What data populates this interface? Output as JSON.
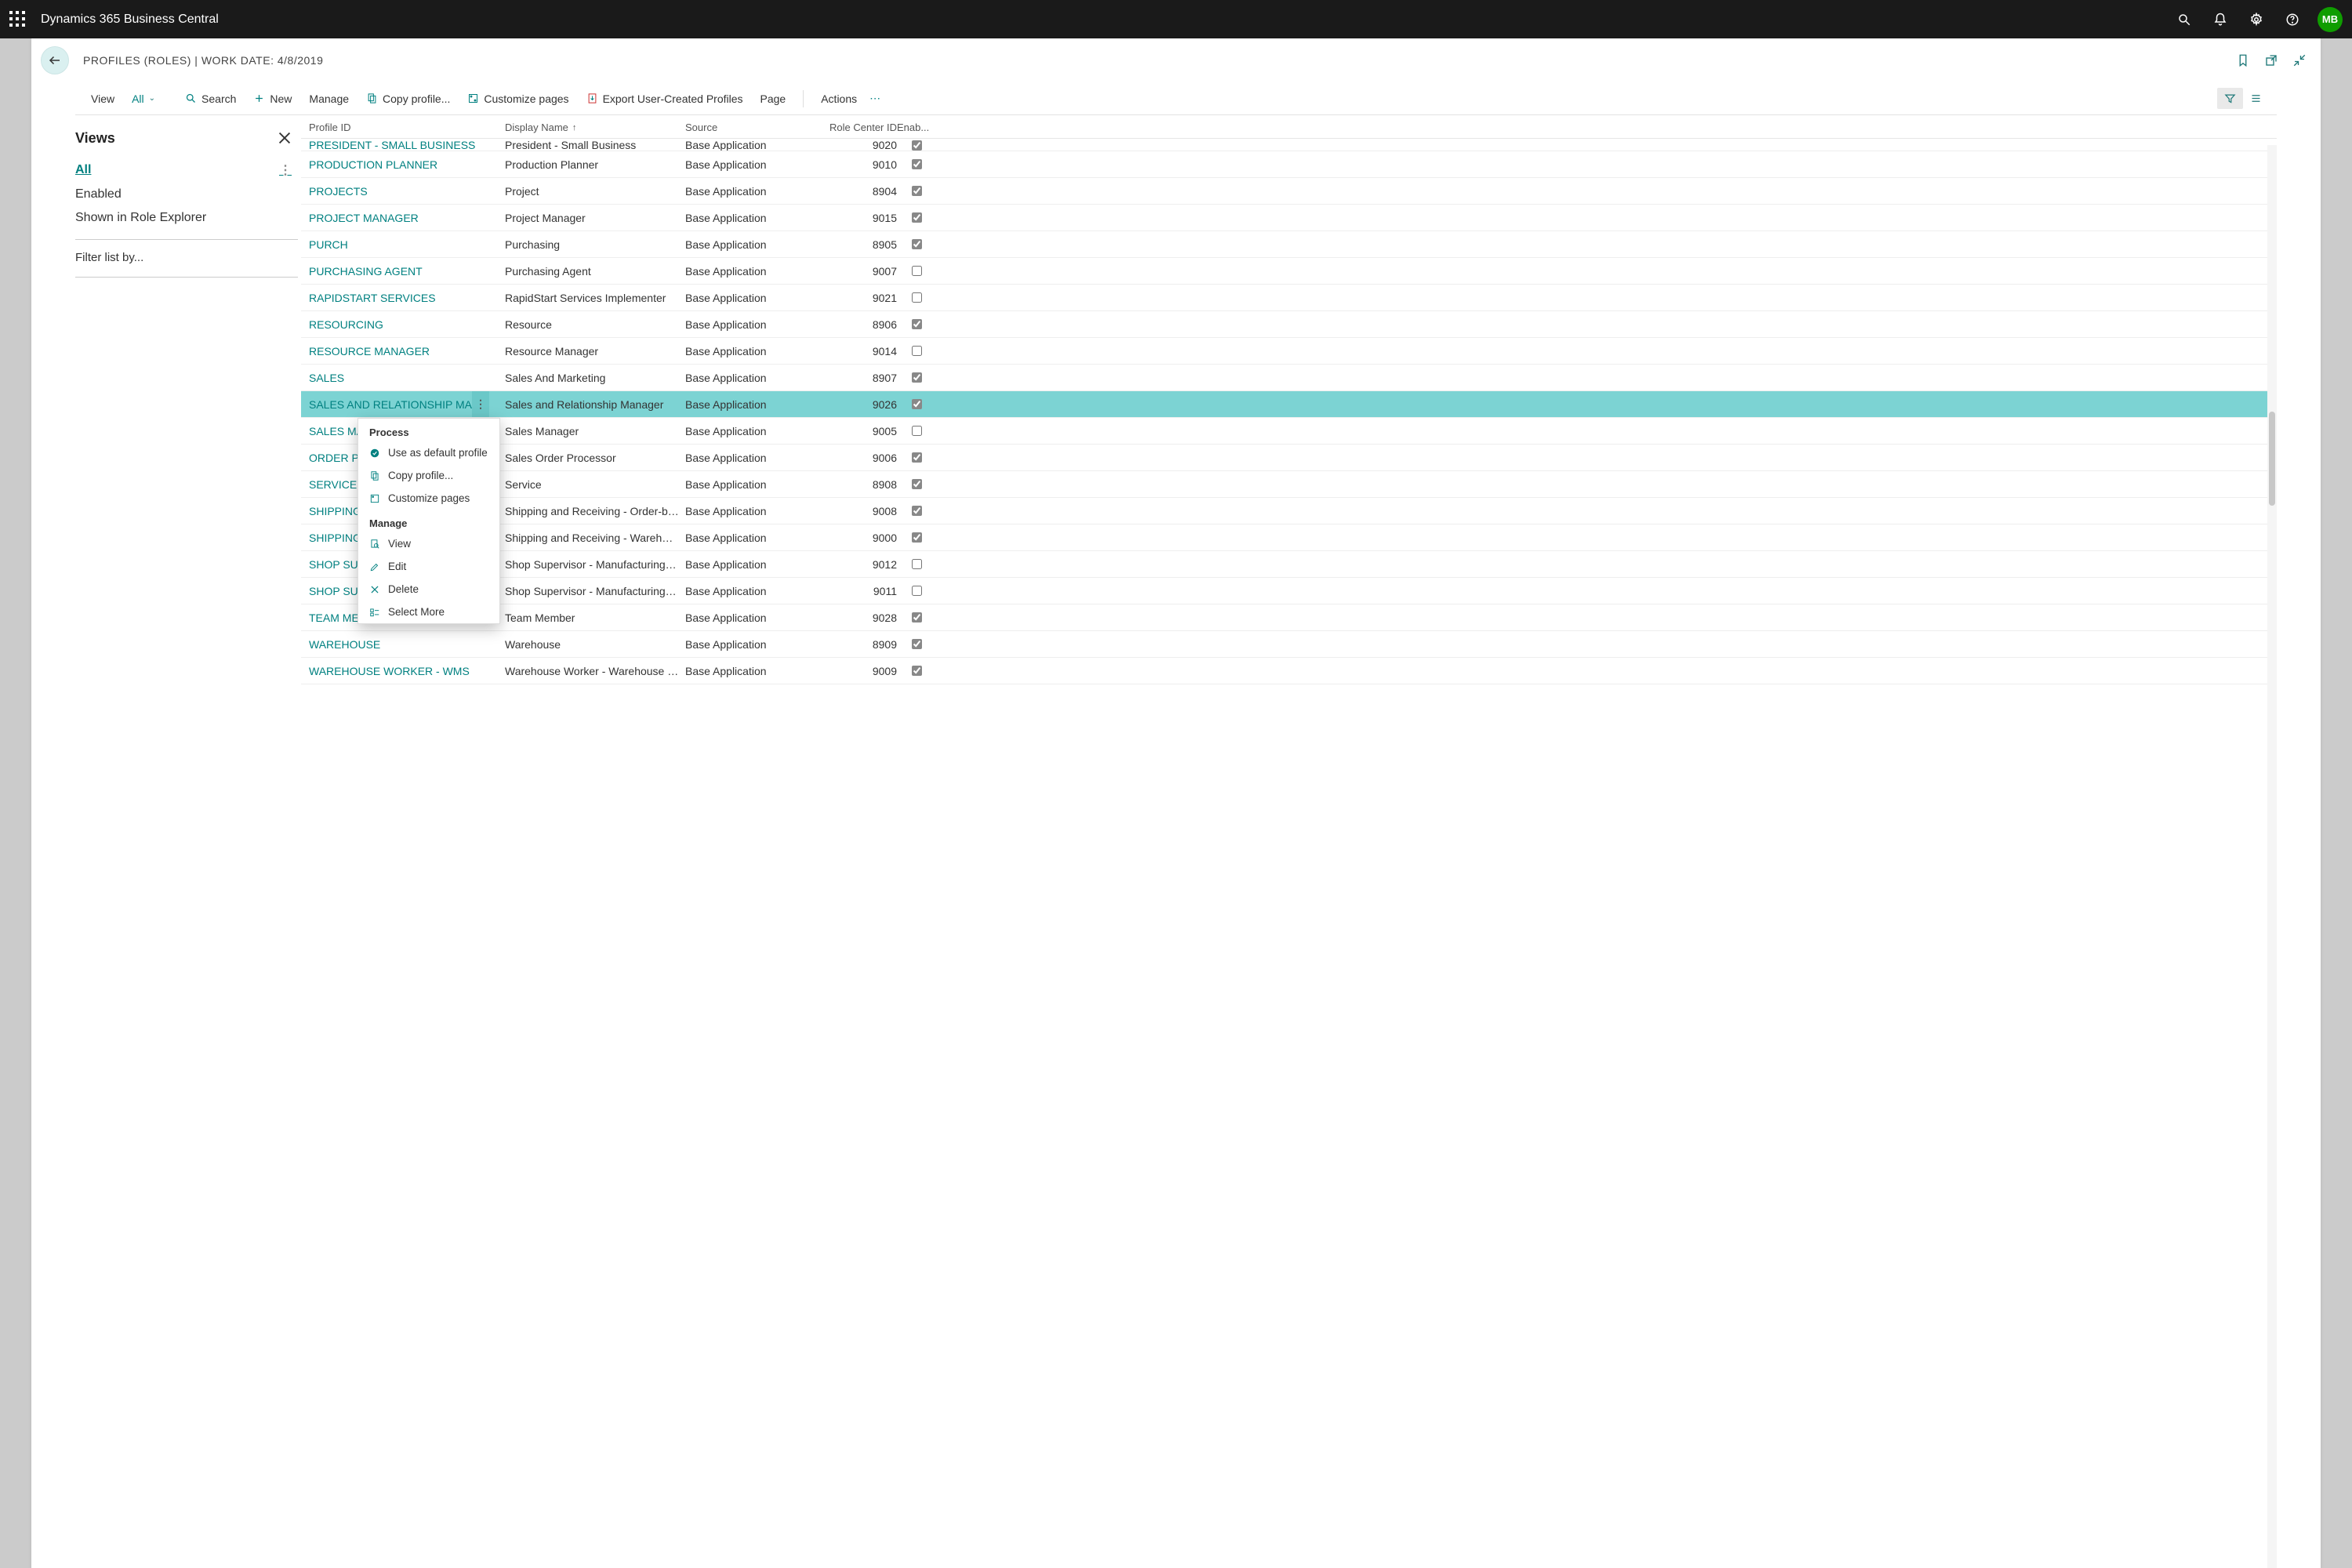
{
  "app_title": "Dynamics 365 Business Central",
  "avatar": "MB",
  "page_header": "PROFILES (ROLES) | WORK DATE: 4/8/2019",
  "toolbar": {
    "view": "View",
    "all": "All",
    "search": "Search",
    "new": "New",
    "manage": "Manage",
    "copy": "Copy profile...",
    "customize": "Customize pages",
    "export": "Export User-Created Profiles",
    "page": "Page",
    "actions": "Actions"
  },
  "sidebar": {
    "views_title": "Views",
    "items": [
      {
        "label": "All",
        "selected": true,
        "more": true
      },
      {
        "label": "Enabled",
        "selected": false
      },
      {
        "label": "Shown in Role Explorer",
        "selected": false
      }
    ],
    "filter_by": "Filter list by..."
  },
  "columns": {
    "profile_id": "Profile ID",
    "display_name": "Display Name",
    "source": "Source",
    "role_center": "Role Center ID",
    "enabled": "Enab..."
  },
  "rows": [
    {
      "pid": "PRESIDENT - SMALL BUSINESS",
      "dn": "President - Small Business",
      "src": "Base Application",
      "rc": "9020",
      "en": true,
      "top": true
    },
    {
      "pid": "PRODUCTION PLANNER",
      "dn": "Production Planner",
      "src": "Base Application",
      "rc": "9010",
      "en": true
    },
    {
      "pid": "PROJECTS",
      "dn": "Project",
      "src": "Base Application",
      "rc": "8904",
      "en": true
    },
    {
      "pid": "PROJECT MANAGER",
      "dn": "Project Manager",
      "src": "Base Application",
      "rc": "9015",
      "en": true
    },
    {
      "pid": "PURCH",
      "dn": "Purchasing",
      "src": "Base Application",
      "rc": "8905",
      "en": true
    },
    {
      "pid": "PURCHASING AGENT",
      "dn": "Purchasing Agent",
      "src": "Base Application",
      "rc": "9007",
      "en": false
    },
    {
      "pid": "RAPIDSTART SERVICES",
      "dn": "RapidStart Services Implementer",
      "src": "Base Application",
      "rc": "9021",
      "en": false
    },
    {
      "pid": "RESOURCING",
      "dn": "Resource",
      "src": "Base Application",
      "rc": "8906",
      "en": true
    },
    {
      "pid": "RESOURCE MANAGER",
      "dn": "Resource Manager",
      "src": "Base Application",
      "rc": "9014",
      "en": false
    },
    {
      "pid": "SALES",
      "dn": "Sales And Marketing",
      "src": "Base Application",
      "rc": "8907",
      "en": true
    },
    {
      "pid": "SALES AND RELATIONSHIP MAN…",
      "dn": "Sales and Relationship Manager",
      "src": "Base Application",
      "rc": "9026",
      "en": true,
      "selected": true
    },
    {
      "pid": "SALES MANAGER",
      "dn": "Sales Manager",
      "src": "Base Application",
      "rc": "9005",
      "en": false
    },
    {
      "pid": "ORDER PROCESSOR",
      "dn": "Sales Order Processor",
      "src": "Base Application",
      "rc": "9006",
      "en": true
    },
    {
      "pid": "SERVICES",
      "dn": "Service",
      "src": "Base Application",
      "rc": "8908",
      "en": true
    },
    {
      "pid": "SHIPPING AND RECEIVING",
      "dn": "Shipping and Receiving - Order-by…",
      "src": "Base Application",
      "rc": "9008",
      "en": true
    },
    {
      "pid": "SHIPPING AND RECEIVING - WMS",
      "dn": "Shipping and Receiving - Warehou…",
      "src": "Base Application",
      "rc": "9000",
      "en": true
    },
    {
      "pid": "SHOP SUPERVISOR",
      "dn": "Shop Supervisor - Manufacturing C…",
      "src": "Base Application",
      "rc": "9012",
      "en": false
    },
    {
      "pid": "SHOP SUPERVISOR - FOUNDATION",
      "dn": "Shop Supervisor - Manufacturing F…",
      "src": "Base Application",
      "rc": "9011",
      "en": false
    },
    {
      "pid": "TEAM MEMBER",
      "dn": "Team Member",
      "src": "Base Application",
      "rc": "9028",
      "en": true
    },
    {
      "pid": "WAREHOUSE",
      "dn": "Warehouse",
      "src": "Base Application",
      "rc": "8909",
      "en": true
    },
    {
      "pid": "WAREHOUSE WORKER - WMS",
      "dn": "Warehouse Worker - Warehouse M…",
      "src": "Base Application",
      "rc": "9009",
      "en": true
    }
  ],
  "context_menu": {
    "section1": "Process",
    "use_default": "Use as default profile",
    "copy": "Copy profile...",
    "customize": "Customize pages",
    "section2": "Manage",
    "view": "View",
    "edit": "Edit",
    "delete": "Delete",
    "select_more": "Select More"
  }
}
